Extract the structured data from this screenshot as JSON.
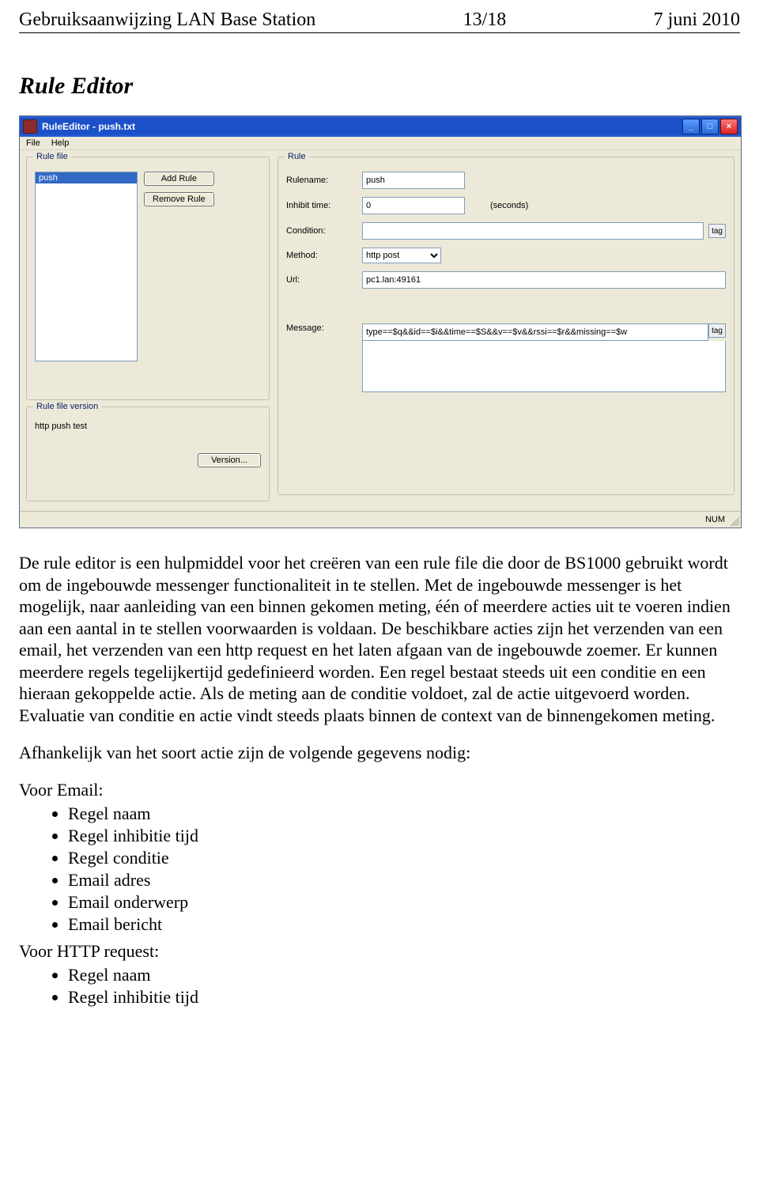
{
  "header": {
    "left": "Gebruiksaanwijzing LAN Base Station",
    "center": "13/18",
    "right": "7 juni 2010"
  },
  "section_title": "Rule Editor",
  "window": {
    "title": "RuleEditor - push.txt",
    "menu": {
      "file": "File",
      "help": "Help"
    },
    "rulefile": {
      "legend": "Rule file",
      "selected": "push",
      "add": "Add Rule",
      "remove": "Remove Rule"
    },
    "version": {
      "legend": "Rule file version",
      "text": "http push test",
      "button": "Version..."
    },
    "rule": {
      "legend": "Rule",
      "labels": {
        "rulename": "Rulename:",
        "inhibit": "Inhibit time:",
        "seconds": "(seconds)",
        "condition": "Condition:",
        "method": "Method:",
        "url": "Url:",
        "message": "Message:"
      },
      "values": {
        "rulename": "push",
        "inhibit": "0",
        "condition": "",
        "method": "http post",
        "url": "pc1.lan:49161",
        "message": "type==$q&&id==$i&&time==$S&&v==$v&&rssi==$r&&missing==$w"
      },
      "tag": "tag"
    },
    "status": {
      "num": "NUM"
    }
  },
  "body": {
    "p1": "De rule editor is een hulpmiddel voor het creëren van een rule file die door de BS1000 gebruikt wordt om de ingebouwde messenger functionaliteit in te stellen. Met de ingebouwde messenger is het mogelijk, naar aanleiding van een binnen gekomen meting, één of meerdere acties uit te voeren indien aan een aantal in te stellen voorwaarden is voldaan. De beschikbare acties zijn het verzenden van een email, het verzenden van een http request en het laten afgaan van de ingebouwde zoemer. Er kunnen meerdere regels tegelijkertijd gedefinieerd worden. Een regel bestaat steeds uit een conditie en een hieraan gekoppelde actie. Als de meting aan de conditie voldoet, zal de actie uitgevoerd worden. Evaluatie van conditie en actie vindt steeds plaats binnen de context van de binnengekomen meting.",
    "p2": "Afhankelijk van het soort actie zijn de volgende gegevens nodig:",
    "email_label": "Voor Email:",
    "email_items": [
      "Regel naam",
      "Regel inhibitie tijd",
      "Regel conditie",
      "Email adres",
      "Email onderwerp",
      "Email bericht"
    ],
    "http_label": "Voor HTTP request:",
    "http_items": [
      "Regel naam",
      "Regel inhibitie tijd"
    ]
  }
}
